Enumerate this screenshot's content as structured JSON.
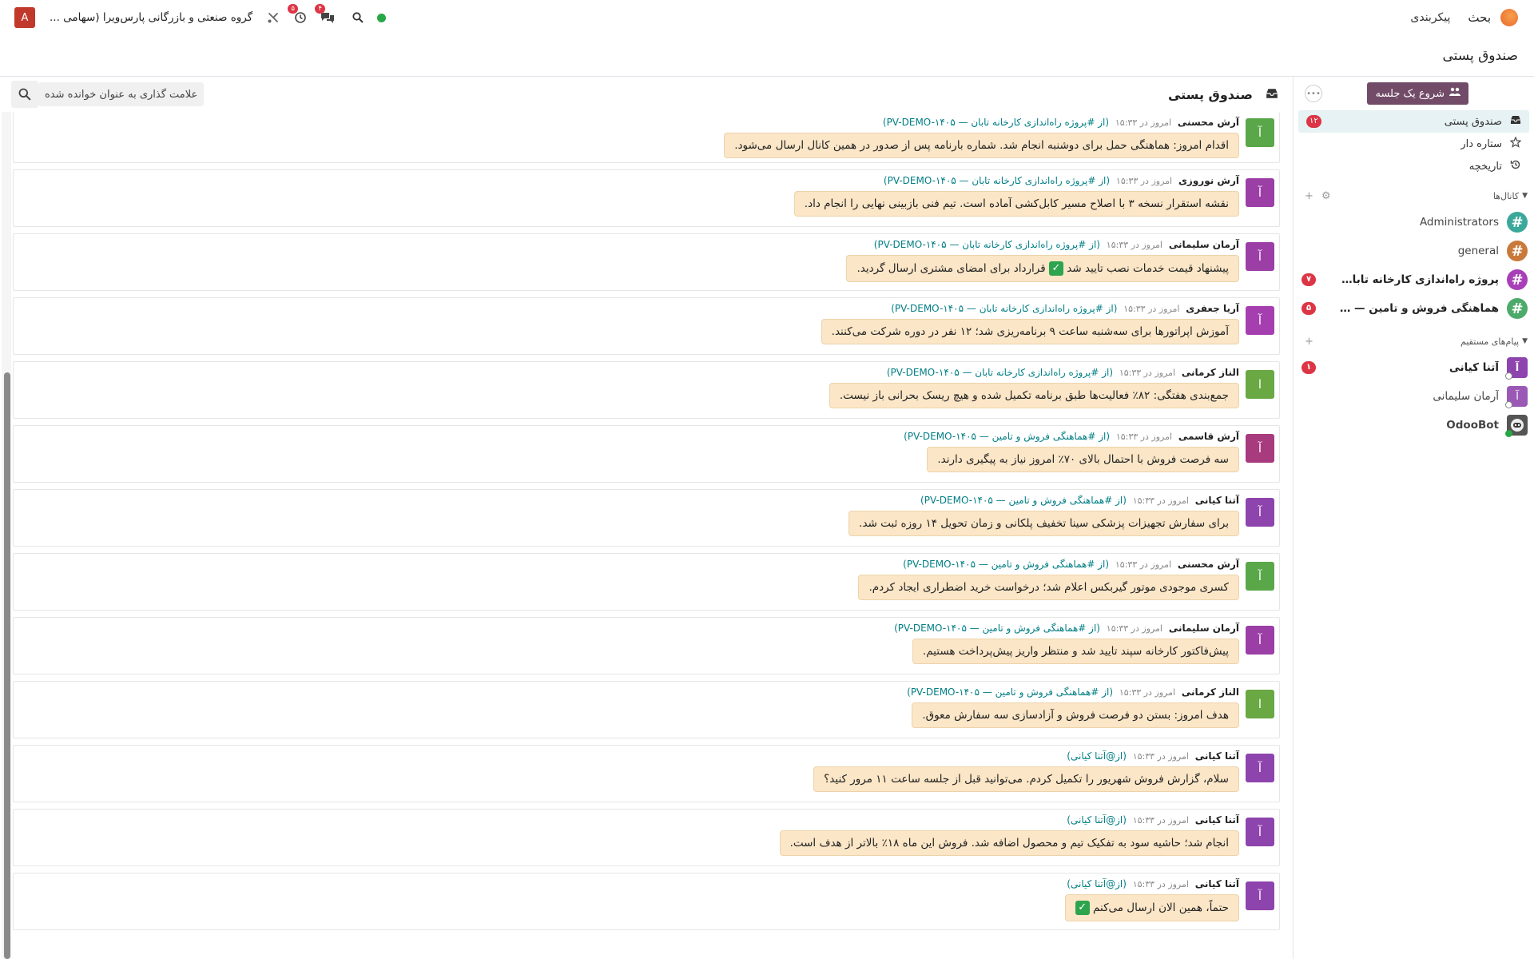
{
  "navbar": {
    "app_name": "بحث",
    "menu_config": "پیکربندی",
    "company": "گروه صنعتی و بازرگانی پارس‌ویرا (سهامی ...",
    "user_initial": "A",
    "activity_count": "۵",
    "chat_count": "۴"
  },
  "breadcrumb": {
    "title": "صندوق پستی"
  },
  "thread": {
    "title": "صندوق پستی",
    "mark_read_label": "علامت گذاری به عنوان خوانده شده"
  },
  "sidebar": {
    "meeting_button": "شروع یک جلسه",
    "mailboxes": [
      {
        "label": "صندوق پستی",
        "badge": "۱۲"
      },
      {
        "label": "ستاره دار",
        "badge": ""
      },
      {
        "label": "تاریخچه",
        "badge": ""
      }
    ],
    "channels_header": "کانال‌ها",
    "channels": [
      {
        "name": "Administrators",
        "badge": "",
        "color": "#3aa89a",
        "bold": false
      },
      {
        "name": "general",
        "badge": "",
        "color": "#c97a3a",
        "bold": false
      },
      {
        "name": "پروژه راه‌اندازی کارخانه تابان — ...",
        "badge": "۷",
        "color": "#a83fb8",
        "bold": true
      },
      {
        "name": "هماهنگی فروش و تامین — ۰۵...",
        "badge": "۵",
        "color": "#4caa6a",
        "bold": true
      }
    ],
    "dm_header": "پیام‌های مستقیم",
    "dms": [
      {
        "name": "آتنا کیانی",
        "badge": "۱",
        "initial": "آ",
        "color": "#8e44ad",
        "bold": true,
        "online": false
      },
      {
        "name": "آرمان سلیمانی",
        "badge": "",
        "initial": "آ",
        "color": "#9b59b6",
        "bold": false,
        "online": false
      },
      {
        "name": "OdooBot",
        "badge": "",
        "initial": "",
        "color": "#555555",
        "bold": false,
        "online": true
      }
    ]
  },
  "common": {
    "time": "امروز در ۱۵:۳۳",
    "from_prefix": "(از",
    "from_suffix": ")"
  },
  "messages": [
    {
      "author": "آرش محسنی",
      "origin": "#پروژه راه‌اندازی کارخانه تابان — PV-DEMO-۱۴۰۵",
      "body": "اقدام امروز: هماهنگی حمل برای دوشنبه انجام شد. شماره بارنامه پس از صدور در همین کانال ارسال می‌شود.",
      "avatar": "آ",
      "color": "#5aa74a",
      "emoji": false
    },
    {
      "author": "آرش نوروزی",
      "origin": "#پروژه راه‌اندازی کارخانه تابان — PV-DEMO-۱۴۰۵",
      "body": "نقشه استقرار نسخه ۳ با اصلاح مسیر کابل‌کشی آماده است. تیم فنی بازبینی نهایی را انجام داد.",
      "avatar": "آ",
      "color": "#9b3fa6",
      "emoji": false
    },
    {
      "author": "آرمان سلیمانی",
      "origin": "#پروژه راه‌اندازی کارخانه تابان — PV-DEMO-۱۴۰۵",
      "body": "پیشنهاد قیمت خدمات نصب تایید شد",
      "body2": "قرارداد برای امضای مشتری ارسال گردید.",
      "avatar": "آ",
      "color": "#9b3fa6",
      "emoji": true
    },
    {
      "author": "آریا جعفری",
      "origin": "#پروژه راه‌اندازی کارخانه تابان — PV-DEMO-۱۴۰۵",
      "body": "آموزش اپراتورها برای سه‌شنبه ساعت ۹ برنامه‌ریزی شد؛ ۱۲ نفر در دوره شرکت می‌کنند.",
      "avatar": "آ",
      "color": "#a53fb0",
      "emoji": false
    },
    {
      "author": "الناز کرمانی",
      "origin": "#پروژه راه‌اندازی کارخانه تابان — PV-DEMO-۱۴۰۵",
      "body": "جمع‌بندی هفتگی: ۸۲٪ فعالیت‌ها طبق برنامه تکمیل شده و هیچ ریسک بحرانی باز نیست.",
      "avatar": "ا",
      "color": "#6aa843",
      "emoji": false
    },
    {
      "author": "آرش قاسمی",
      "origin": "#هماهنگی فروش و تامین — PV-DEMO-۱۴۰۵",
      "body": "سه فرصت فروش با احتمال بالای ۷۰٪ امروز نیاز به پیگیری دارند.",
      "avatar": "آ",
      "color": "#a83a7e",
      "emoji": false
    },
    {
      "author": "آتنا کیانی",
      "origin": "#هماهنگی فروش و تامین — PV-DEMO-۱۴۰۵",
      "body": "برای سفارش تجهیزات پزشکی سینا تخفیف پلکانی و زمان تحویل ۱۴ روزه ثبت شد.",
      "avatar": "آ",
      "color": "#8e44ad",
      "emoji": false
    },
    {
      "author": "آرش محسنی",
      "origin": "#هماهنگی فروش و تامین — PV-DEMO-۱۴۰۵",
      "body": "کسری موجودی موتور گیربکس اعلام شد؛ درخواست خرید اضطراری ایجاد کردم.",
      "avatar": "آ",
      "color": "#5aa74a",
      "emoji": false
    },
    {
      "author": "آرمان سلیمانی",
      "origin": "#هماهنگی فروش و تامین — PV-DEMO-۱۴۰۵",
      "body": "پیش‌فاکتور کارخانه سپند تایید شد و منتظر واریز پیش‌پرداخت هستیم.",
      "avatar": "آ",
      "color": "#9b3fa6",
      "emoji": false
    },
    {
      "author": "الناز کرمانی",
      "origin": "#هماهنگی فروش و تامین — PV-DEMO-۱۴۰۵",
      "body": "هدف امروز: بستن دو فرصت فروش و آزادسازی سه سفارش معوق.",
      "avatar": "ا",
      "color": "#6aa843",
      "emoji": false
    },
    {
      "author": "آتنا کیانی",
      "origin": "@آتنا کیانی",
      "body": "سلام، گزارش فروش شهریور را تکمیل کردم. می‌توانید قبل از جلسه ساعت ۱۱ مرور کنید؟",
      "avatar": "آ",
      "color": "#8e44ad",
      "emoji": false
    },
    {
      "author": "آتنا کیانی",
      "origin": "@آتنا کیانی",
      "body": "انجام شد؛ حاشیه سود به تفکیک تیم و محصول اضافه شد. فروش این ماه ۱۸٪ بالاتر از هدف است.",
      "avatar": "آ",
      "color": "#8e44ad",
      "emoji": false
    },
    {
      "author": "آتنا کیانی",
      "origin": "@آتنا کیانی",
      "body": "حتماً، همین الان ارسال می‌کنم",
      "avatar": "آ",
      "color": "#8e44ad",
      "emoji": true,
      "emoji_end": true
    }
  ]
}
